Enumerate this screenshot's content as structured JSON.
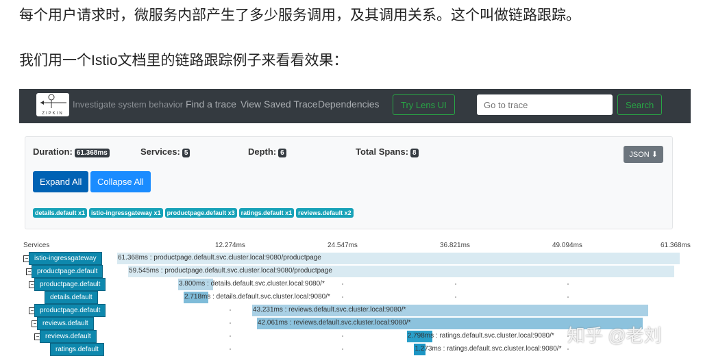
{
  "article": {
    "line1": "每个用户请求时，微服务内部产生了多少服务调用，及其调用关系。这个叫做链路跟踪。",
    "line2": "我们用一个Istio文档里的链路跟踪例子来看看效果："
  },
  "header": {
    "logo": "ZIPKIN",
    "tagline": "Investigate system behavior",
    "nav": [
      "Find a trace",
      "View Saved Trace",
      "Dependencies"
    ],
    "try_lens": "Try Lens UI",
    "search_placeholder": "Go to trace",
    "search_button": "Search"
  },
  "summary": {
    "duration_label": "Duration:",
    "duration": "61.368ms",
    "services_label": "Services:",
    "services": "5",
    "depth_label": "Depth:",
    "depth": "6",
    "spans_label": "Total Spans:",
    "spans": "8",
    "json": "JSON ⬇",
    "expand": "Expand All",
    "collapse": "Collapse All",
    "tags": [
      "details.default x1",
      "istio-ingressgateway x1",
      "productpage.default x3",
      "ratings.default x1",
      "reviews.default x2"
    ]
  },
  "timeline": {
    "services_header": "Services",
    "ticks": [
      "12.274ms",
      "24.547ms",
      "36.821ms",
      "49.094ms",
      "61.368ms"
    ],
    "total_ms": 61.368,
    "spans": [
      {
        "service": "istio-ingressgateway",
        "depth": 0,
        "toggle": true,
        "start_ms": 0,
        "duration_ms": 61.368,
        "label": "61.368ms : productpage.default.svc.cluster.local:9080/productpage",
        "color": "#d9eaf2"
      },
      {
        "service": "productpage.default",
        "depth": 1,
        "toggle": true,
        "start_ms": 1.2,
        "duration_ms": 59.545,
        "label": "59.545ms : productpage.default.svc.cluster.local:9080/productpage",
        "color": "#d9eaf2"
      },
      {
        "service": "productpage.default",
        "depth": 2,
        "toggle": true,
        "start_ms": 6.65,
        "duration_ms": 3.8,
        "label": "3.800ms : details.default.svc.cluster.local:9080/*",
        "color": "#b6d7e8"
      },
      {
        "service": "details.default",
        "depth": 3,
        "toggle": false,
        "start_ms": 7.25,
        "duration_ms": 2.718,
        "label": "2.718ms : details.default.svc.cluster.local:9080/*",
        "color": "#7fbcd9"
      },
      {
        "service": "productpage.default",
        "depth": 2,
        "toggle": true,
        "start_ms": 14.72,
        "duration_ms": 43.231,
        "label": "43.231ms : reviews.default.svc.cluster.local:9080/*",
        "color": "#a9d0e5"
      },
      {
        "service": "reviews.default",
        "depth": 3,
        "toggle": true,
        "start_ms": 15.25,
        "duration_ms": 42.061,
        "label": "42.061ms : reviews.default.svc.cluster.local:9080/*",
        "color": "#8cc2dd"
      },
      {
        "service": "reviews.default",
        "depth": 4,
        "toggle": true,
        "start_ms": 31.6,
        "duration_ms": 2.798,
        "label": "2.798ms : ratings.default.svc.cluster.local:9080/*",
        "color": "#2a9fc9"
      },
      {
        "service": "ratings.default",
        "depth": 5,
        "toggle": false,
        "start_ms": 32.4,
        "duration_ms": 1.273,
        "label": "1.273ms : ratings.default.svc.cluster.local:9080/*",
        "color": "#1c95c4"
      }
    ]
  },
  "watermark": "知乎 @老刘"
}
